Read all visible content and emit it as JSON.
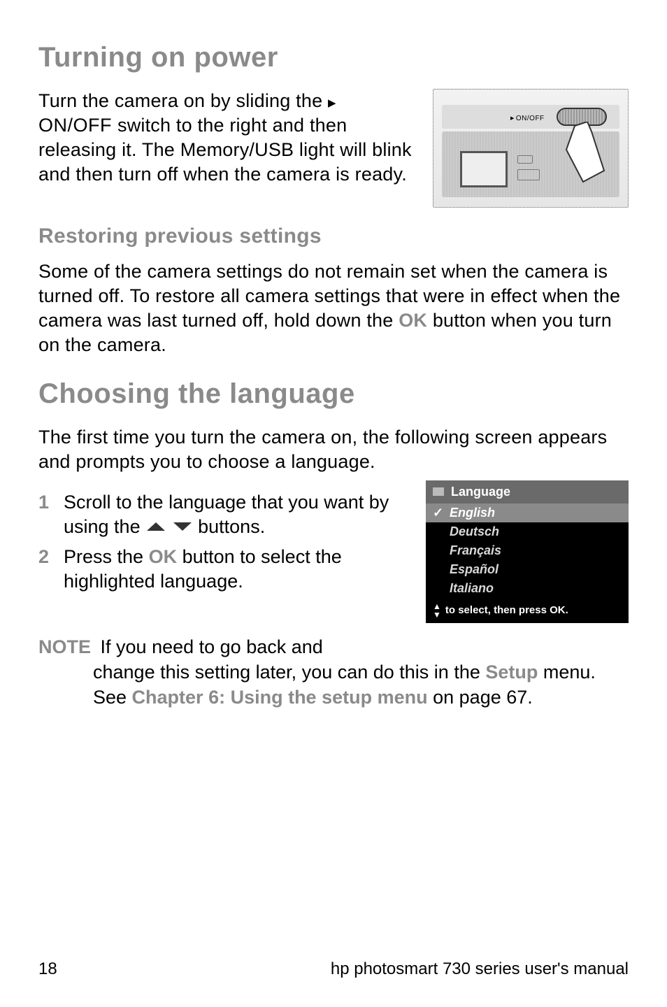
{
  "headings": {
    "h1a": "Turning on power",
    "h2a": "Restoring previous settings",
    "h1b": "Choosing the language"
  },
  "power": {
    "p1_a": "Turn the camera on by sliding the ",
    "p1_tri": "▶",
    "p1_onoff": " ON/OFF ",
    "p1_b": "switch to the right and then releasing it. The Memory/USB light will blink and then turn off when the camera is ready.",
    "illus_label": "ON/OFF"
  },
  "restore": {
    "p": "Some of the camera settings do not remain set when the camera is turned off. To restore all camera settings that were in effect when the camera was last turned off, hold down the ",
    "ok": "OK",
    "p2": " button when you turn on the camera."
  },
  "lang": {
    "intro": "The first time you turn the camera on, the following screen appears and prompts you to choose a language.",
    "step1_a": "Scroll to the language that you want by using the ",
    "step1_b": " buttons.",
    "step2_a": "Press the ",
    "step2_ok": "OK",
    "step2_b": " button to select the highlighted language.",
    "nums": {
      "one": "1",
      "two": "2"
    },
    "screen": {
      "header": "Language",
      "items": [
        "English",
        "Deutsch",
        "Français",
        "Español",
        "Italiano"
      ],
      "footer": "to select, then press OK."
    }
  },
  "note": {
    "label": "NOTE",
    "a": "If you need to go back and",
    "b": "change this setting later, you can do this in the ",
    "setup": "Setup",
    "c": " menu. See ",
    "chapter": "Chapter 6: Using the setup menu",
    "d": " on page 67."
  },
  "footer": {
    "page": "18",
    "title": "hp photosmart 730 series user's manual"
  }
}
